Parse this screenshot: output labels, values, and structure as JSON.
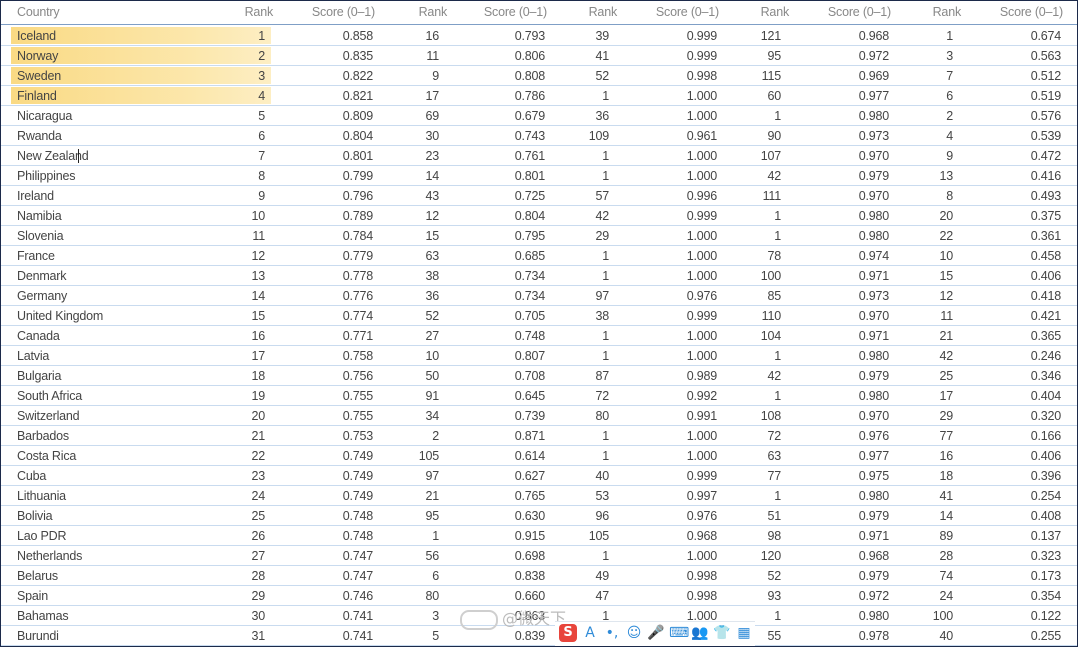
{
  "columns": [
    "Country",
    "Rank",
    "Score (0–1)",
    "Rank",
    "Score (0–1)",
    "Rank",
    "Score (0–1)",
    "Rank",
    "Score (0–1)",
    "Rank",
    "Score (0–1)"
  ],
  "rows": [
    {
      "country": "Iceland",
      "cells": [
        "1",
        "0.858",
        "16",
        "0.793",
        "39",
        "0.999",
        "121",
        "0.968",
        "1",
        "0.674"
      ],
      "highlighted": true
    },
    {
      "country": "Norway",
      "cells": [
        "2",
        "0.835",
        "11",
        "0.806",
        "41",
        "0.999",
        "95",
        "0.972",
        "3",
        "0.563"
      ],
      "highlighted": true
    },
    {
      "country": "Sweden",
      "cells": [
        "3",
        "0.822",
        "9",
        "0.808",
        "52",
        "0.998",
        "115",
        "0.969",
        "7",
        "0.512"
      ],
      "highlighted": true
    },
    {
      "country": "Finland",
      "cells": [
        "4",
        "0.821",
        "17",
        "0.786",
        "1",
        "1.000",
        "60",
        "0.977",
        "6",
        "0.519"
      ],
      "highlighted": true
    },
    {
      "country": "Nicaragua",
      "cells": [
        "5",
        "0.809",
        "69",
        "0.679",
        "36",
        "1.000",
        "1",
        "0.980",
        "2",
        "0.576"
      ]
    },
    {
      "country": "Rwanda",
      "cells": [
        "6",
        "0.804",
        "30",
        "0.743",
        "109",
        "0.961",
        "90",
        "0.973",
        "4",
        "0.539"
      ]
    },
    {
      "country": "New Zealand",
      "cells": [
        "7",
        "0.801",
        "23",
        "0.761",
        "1",
        "1.000",
        "107",
        "0.970",
        "9",
        "0.472"
      ]
    },
    {
      "country": "Philippines",
      "cells": [
        "8",
        "0.799",
        "14",
        "0.801",
        "1",
        "1.000",
        "42",
        "0.979",
        "13",
        "0.416"
      ]
    },
    {
      "country": "Ireland",
      "cells": [
        "9",
        "0.796",
        "43",
        "0.725",
        "57",
        "0.996",
        "111",
        "0.970",
        "8",
        "0.493"
      ]
    },
    {
      "country": "Namibia",
      "cells": [
        "10",
        "0.789",
        "12",
        "0.804",
        "42",
        "0.999",
        "1",
        "0.980",
        "20",
        "0.375"
      ]
    },
    {
      "country": "Slovenia",
      "cells": [
        "11",
        "0.784",
        "15",
        "0.795",
        "29",
        "1.000",
        "1",
        "0.980",
        "22",
        "0.361"
      ]
    },
    {
      "country": "France",
      "cells": [
        "12",
        "0.779",
        "63",
        "0.685",
        "1",
        "1.000",
        "78",
        "0.974",
        "10",
        "0.458"
      ]
    },
    {
      "country": "Denmark",
      "cells": [
        "13",
        "0.778",
        "38",
        "0.734",
        "1",
        "1.000",
        "100",
        "0.971",
        "15",
        "0.406"
      ]
    },
    {
      "country": "Germany",
      "cells": [
        "14",
        "0.776",
        "36",
        "0.734",
        "97",
        "0.976",
        "85",
        "0.973",
        "12",
        "0.418"
      ]
    },
    {
      "country": "United Kingdom",
      "cells": [
        "15",
        "0.774",
        "52",
        "0.705",
        "38",
        "0.999",
        "110",
        "0.970",
        "11",
        "0.421"
      ]
    },
    {
      "country": "Canada",
      "cells": [
        "16",
        "0.771",
        "27",
        "0.748",
        "1",
        "1.000",
        "104",
        "0.971",
        "21",
        "0.365"
      ]
    },
    {
      "country": "Latvia",
      "cells": [
        "17",
        "0.758",
        "10",
        "0.807",
        "1",
        "1.000",
        "1",
        "0.980",
        "42",
        "0.246"
      ]
    },
    {
      "country": "Bulgaria",
      "cells": [
        "18",
        "0.756",
        "50",
        "0.708",
        "87",
        "0.989",
        "42",
        "0.979",
        "25",
        "0.346"
      ]
    },
    {
      "country": "South Africa",
      "cells": [
        "19",
        "0.755",
        "91",
        "0.645",
        "72",
        "0.992",
        "1",
        "0.980",
        "17",
        "0.404"
      ]
    },
    {
      "country": "Switzerland",
      "cells": [
        "20",
        "0.755",
        "34",
        "0.739",
        "80",
        "0.991",
        "108",
        "0.970",
        "29",
        "0.320"
      ]
    },
    {
      "country": "Barbados",
      "cells": [
        "21",
        "0.753",
        "2",
        "0.871",
        "1",
        "1.000",
        "72",
        "0.976",
        "77",
        "0.166"
      ]
    },
    {
      "country": "Costa Rica",
      "cells": [
        "22",
        "0.749",
        "105",
        "0.614",
        "1",
        "1.000",
        "63",
        "0.977",
        "16",
        "0.406"
      ]
    },
    {
      "country": "Cuba",
      "cells": [
        "23",
        "0.749",
        "97",
        "0.627",
        "40",
        "0.999",
        "77",
        "0.975",
        "18",
        "0.396"
      ]
    },
    {
      "country": "Lithuania",
      "cells": [
        "24",
        "0.749",
        "21",
        "0.765",
        "53",
        "0.997",
        "1",
        "0.980",
        "41",
        "0.254"
      ]
    },
    {
      "country": "Bolivia",
      "cells": [
        "25",
        "0.748",
        "95",
        "0.630",
        "96",
        "0.976",
        "51",
        "0.979",
        "14",
        "0.408"
      ]
    },
    {
      "country": "Lao PDR",
      "cells": [
        "26",
        "0.748",
        "1",
        "0.915",
        "105",
        "0.968",
        "98",
        "0.971",
        "89",
        "0.137"
      ]
    },
    {
      "country": "Netherlands",
      "cells": [
        "27",
        "0.747",
        "56",
        "0.698",
        "1",
        "1.000",
        "120",
        "0.968",
        "28",
        "0.323"
      ]
    },
    {
      "country": "Belarus",
      "cells": [
        "28",
        "0.747",
        "6",
        "0.838",
        "49",
        "0.998",
        "52",
        "0.979",
        "74",
        "0.173"
      ]
    },
    {
      "country": "Spain",
      "cells": [
        "29",
        "0.746",
        "80",
        "0.660",
        "47",
        "0.998",
        "93",
        "0.972",
        "24",
        "0.354"
      ]
    },
    {
      "country": "Bahamas",
      "cells": [
        "30",
        "0.741",
        "3",
        "0.863",
        "1",
        "1.000",
        "1",
        "0.980",
        "100",
        "0.122"
      ]
    },
    {
      "country": "Burundi",
      "cells": [
        "31",
        "0.741",
        "5",
        "0.839",
        "",
        "",
        "55",
        "0.978",
        "40",
        "0.255"
      ]
    }
  ],
  "watermark": {
    "text": "@微天下"
  },
  "toolbar": {
    "icons": [
      "S",
      "A",
      "•,",
      "☺",
      "🎤",
      "⌨",
      "👥",
      "👕",
      "▦"
    ]
  },
  "colors": {
    "highlight": "#f9d36e",
    "header_line": "#7f9fc6",
    "row_line": "#c9dbef",
    "border": "#1c2a4a",
    "toolbar_icon": "#2f8bd8"
  }
}
